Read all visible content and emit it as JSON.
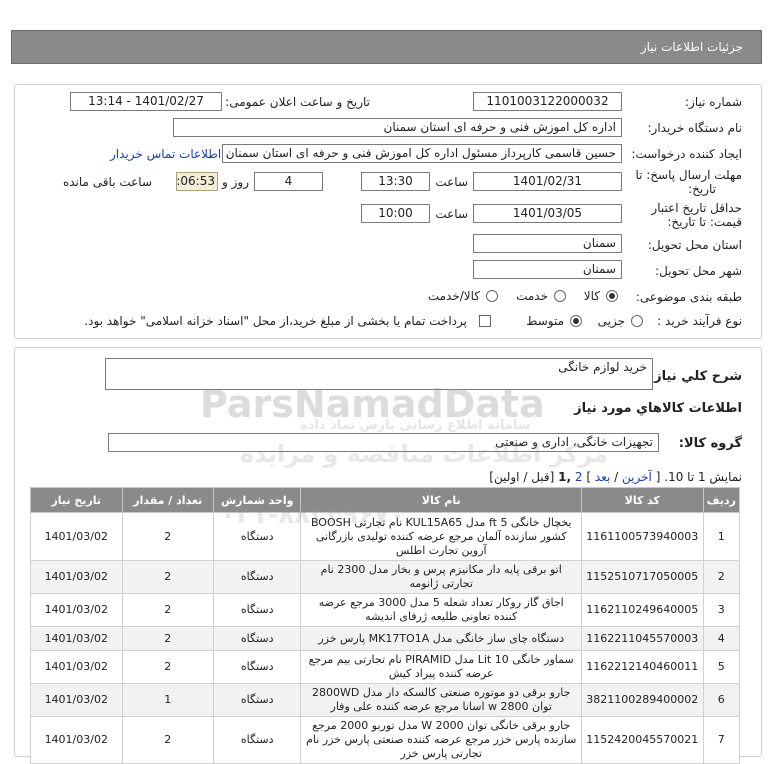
{
  "header": {
    "title": "جزئیات اطلاعات نیاز"
  },
  "form": {
    "need_number_label": "شماره نیاز:",
    "need_number": "1101003122000032",
    "announce_label": "تاریخ و ساعت اعلان عمومی:",
    "announce_value": "1401/02/27 - 13:14",
    "buyer_label": "نام دستگاه خریدار:",
    "buyer_value": "اداره کل اموزش فنی و حرفه ای استان سمنان",
    "creator_label": "ایجاد کننده درخواست:",
    "creator_value": "حسین  قاسمی کارپرداز مسئول اداره کل اموزش فنی و حرفه ای استان سمنان",
    "contact_link": "اطلاعات تماس خریدار",
    "deadline_label_1": "مهلت ارسال پاسخ: تا",
    "deadline_label_2": "تاریخ:",
    "deadline_date": "1401/02/31",
    "time_label": "ساعت",
    "deadline_time": "13:30",
    "days_value": "4",
    "days_label": "روز و",
    "remaining_value": "00:06:53",
    "remaining_label": "ساعت باقی مانده",
    "validity_label_1": "حداقل تاریخ اعتبار",
    "validity_label_2": "قیمت: تا تاریخ:",
    "validity_date": "1401/03/05",
    "validity_time_label": "ساعت",
    "validity_time": "10:00",
    "province_label": "استان محل تحویل:",
    "province_value": "سمنان",
    "city_label": "شهر محل تحویل:",
    "city_value": "سمنان",
    "category_label": "طبقه بندی موضوعی:",
    "cat_goods": "کالا",
    "cat_service": "خدمت",
    "cat_both": "کالا/خدمت",
    "process_label": "نوع فرآیند خرید :",
    "proc_partial": "جزیی",
    "proc_medium": "متوسط",
    "payment_note": "پرداخت تمام یا بخشی از مبلغ خرید،از محل \"اسناد خزانه اسلامی\" خواهد بود."
  },
  "summary": {
    "desc_label": "شرح کلي نياز:",
    "desc_value": "خرید لوازم خانگی",
    "goods_info_title": "اطلاعات کالاهاي مورد نياز",
    "group_label": "گروه کالا:",
    "group_value": "تجهیزات خانگی، اداری و صنعتی"
  },
  "pagination": {
    "show_text": "نمایش 1 تا 10.",
    "bracket_open": "[",
    "last": "آخرین",
    "slash1": "/",
    "next": "بعد",
    "bracket_close": "]",
    "page2": "2",
    "page1": ",1",
    "first_prev": "[قبل / اولین]"
  },
  "table": {
    "headers": [
      "ردیف",
      "کد کالا",
      "نام کالا",
      "واحد شمارش",
      "تعداد / مقدار",
      "تاریخ نیاز"
    ],
    "rows": [
      {
        "idx": "1",
        "code": "1161100573940003",
        "name": "یخچال خانگی 5 ft مدل KUL15A65 نام تجارتی BOOSH کشور سازنده آلمان مرجع عرضه کننده تولیدی بازرگانی آروین تجارت اطلس",
        "unit": "دستگاه",
        "qty": "2",
        "date": "1401/03/02"
      },
      {
        "idx": "2",
        "code": "1152510717050005",
        "name": "اتو برقی پایه دار مکانیزم پرس و بخار مدل 2300 نام تجارتی ژانومه",
        "unit": "دستگاه",
        "qty": "2",
        "date": "1401/03/02"
      },
      {
        "idx": "3",
        "code": "1162110249640005",
        "name": "اجاق گاز روکار تعداد شعله 5 مدل 3000 مرجع عرضه کننده تعاونی طلیعه ژرفای اندیشه",
        "unit": "دستگاه",
        "qty": "2",
        "date": "1401/03/02"
      },
      {
        "idx": "4",
        "code": "1162211045570003",
        "name": "دستگاه چای ساز خانگی مدل MK17TO1A پارس خزر",
        "unit": "دستگاه",
        "qty": "2",
        "date": "1401/03/02"
      },
      {
        "idx": "5",
        "code": "1162212140460011",
        "name": "سماور خانگی 10 Lit مدل PIRAMID نام تجارتی بیم مرجع عرضه کننده پیراد کیش",
        "unit": "دستگاه",
        "qty": "2",
        "date": "1401/03/02"
      },
      {
        "idx": "6",
        "code": "3821100289400002",
        "name": "جارو برقی دو موتوره صنعتی کالسکه دار مدل 2800WD توان 2800 w اسانا مرجع عرضه کننده علی وفار",
        "unit": "دستگاه",
        "qty": "1",
        "date": "1401/03/02"
      },
      {
        "idx": "7",
        "code": "1152420045570021",
        "name": "جارو برقی خانگی توان 2000 W مدل توربو 2000 مرجع سازنده پارس خزر مرجع عرضه کننده صنعتی پارس خزر نام تجارتی پارس خزر",
        "unit": "دستگاه",
        "qty": "2",
        "date": "1401/03/02"
      }
    ]
  },
  "watermark": {
    "main": "ParsNamadData",
    "sub": "مرکز اطلاعات مناقصه و مزایده",
    "phone": "۰۲۱-۸۸۳۴۹۶۷۰",
    "line2": "سامانه اطلاع رسانی پارس نماد داده"
  }
}
